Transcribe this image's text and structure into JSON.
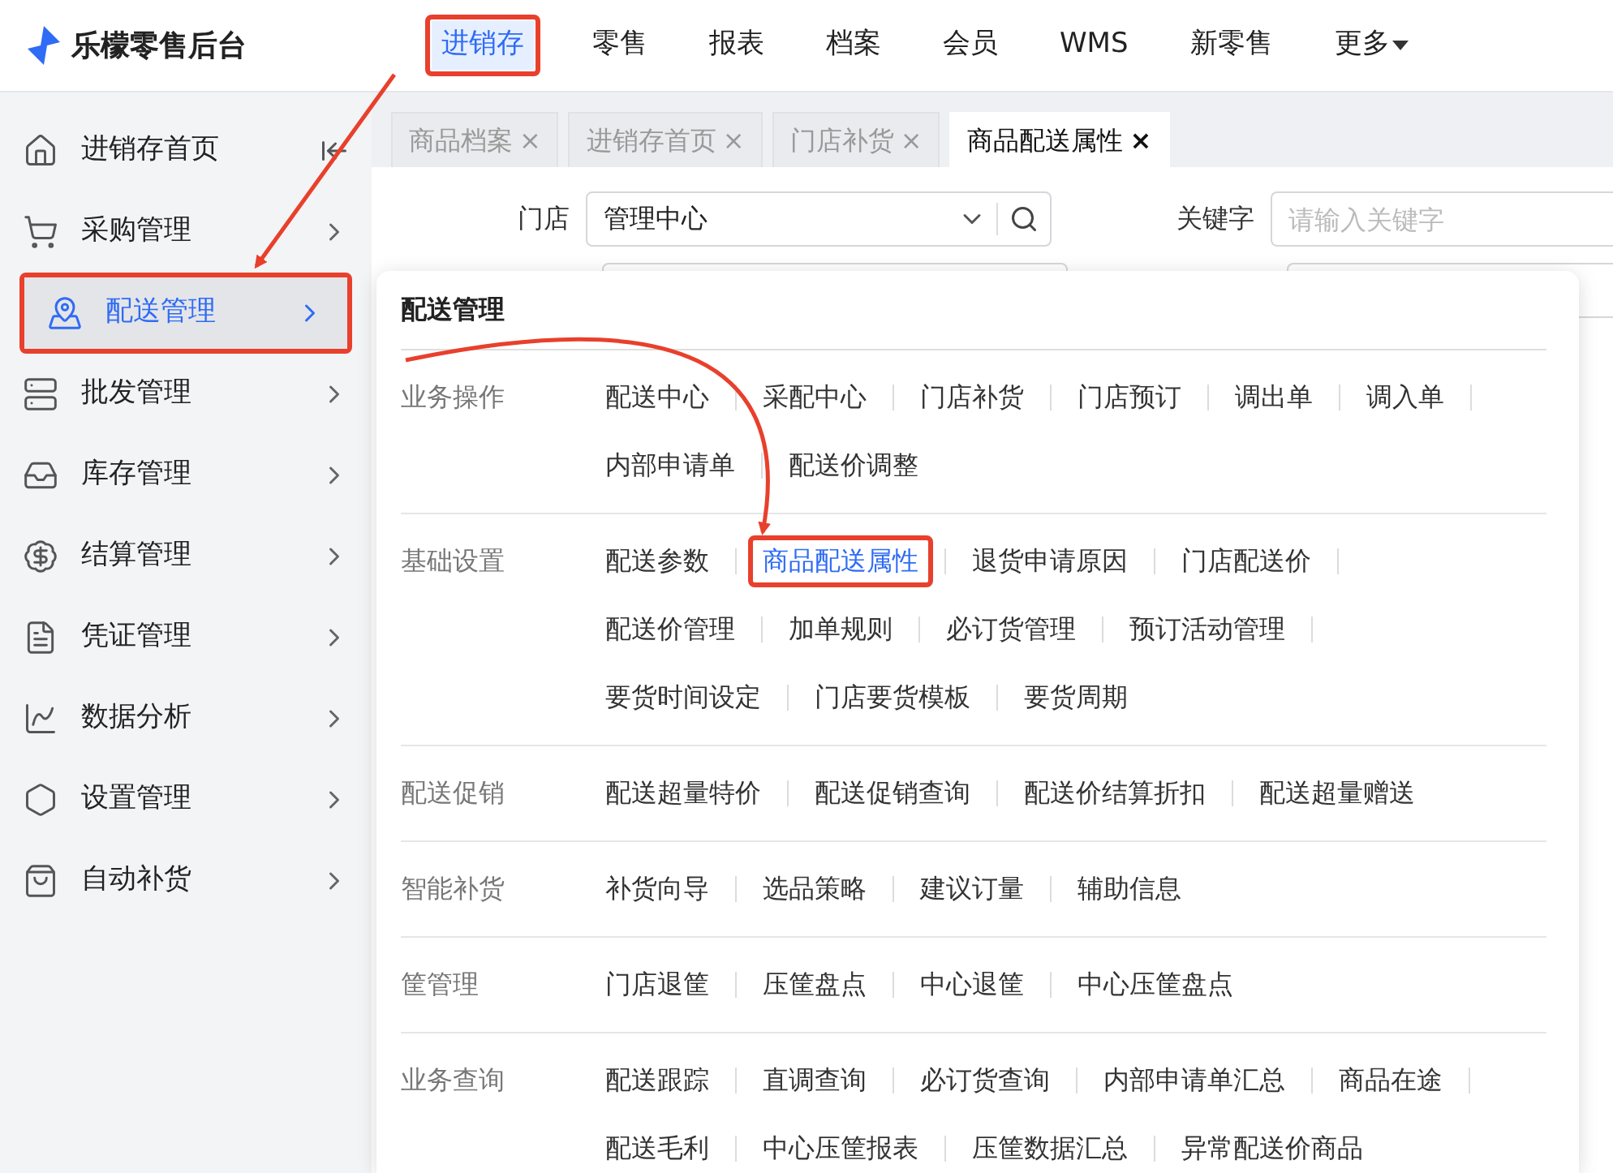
{
  "brand": {
    "name": "乐檬零售后台"
  },
  "nav": [
    {
      "label": "进销存",
      "selected": true,
      "annotated": true,
      "kind": "plain"
    },
    {
      "label": "零售",
      "selected": false,
      "annotated": false,
      "kind": "plain"
    },
    {
      "label": "报表",
      "selected": false,
      "annotated": false,
      "kind": "plain"
    },
    {
      "label": "档案",
      "selected": false,
      "annotated": false,
      "kind": "plain"
    },
    {
      "label": "会员",
      "selected": false,
      "annotated": false,
      "kind": "plain"
    },
    {
      "label": "WMS",
      "selected": false,
      "annotated": false,
      "kind": "plain"
    },
    {
      "label": "新零售",
      "selected": false,
      "annotated": false,
      "kind": "plain"
    },
    {
      "label": "更多",
      "selected": false,
      "annotated": false,
      "kind": "dropdown"
    }
  ],
  "sidebar": {
    "items": [
      {
        "label": "进销存首页",
        "kind": "home",
        "selected": false,
        "annotated": false
      },
      {
        "label": "采购管理",
        "kind": "cart",
        "selected": false,
        "annotated": false
      },
      {
        "label": "配送管理",
        "kind": "map",
        "selected": true,
        "annotated": true
      },
      {
        "label": "批发管理",
        "kind": "server",
        "selected": false,
        "annotated": false
      },
      {
        "label": "库存管理",
        "kind": "box",
        "selected": false,
        "annotated": false
      },
      {
        "label": "结算管理",
        "kind": "money",
        "selected": false,
        "annotated": false
      },
      {
        "label": "凭证管理",
        "kind": "doc",
        "selected": false,
        "annotated": false
      },
      {
        "label": "数据分析",
        "kind": "chart",
        "selected": false,
        "annotated": false
      },
      {
        "label": "设置管理",
        "kind": "settings",
        "selected": false,
        "annotated": false
      },
      {
        "label": "自动补货",
        "kind": "bag",
        "selected": false,
        "annotated": false
      }
    ]
  },
  "tabs": [
    {
      "label": "商品档案",
      "close": "×",
      "selected": false
    },
    {
      "label": "进销存首页",
      "close": "×",
      "selected": false
    },
    {
      "label": "门店补货",
      "close": "×",
      "selected": false
    },
    {
      "label": "商品配送属性",
      "close": "×",
      "selected": true
    }
  ],
  "filters": {
    "store_label": "门店",
    "store_value": "管理中心",
    "keyword_label": "关键字",
    "keyword_placeholder": "请输入关键字"
  },
  "menu": {
    "title": "配送管理",
    "sections": [
      {
        "label": "业务操作",
        "rows": [
          [
            {
              "label": "配送中心",
              "selected": false,
              "annotated": false
            },
            {
              "label": "采配中心",
              "selected": false,
              "annotated": false
            },
            {
              "label": "门店补货",
              "selected": false,
              "annotated": false
            },
            {
              "label": "门店预订",
              "selected": false,
              "annotated": false
            },
            {
              "label": "调出单",
              "selected": false,
              "annotated": false
            },
            {
              "label": "调入单",
              "selected": false,
              "annotated": false
            }
          ],
          [
            {
              "label": "内部申请单",
              "selected": false,
              "annotated": false
            },
            {
              "label": "配送价调整",
              "selected": false,
              "annotated": false
            }
          ]
        ]
      },
      {
        "label": "基础设置",
        "rows": [
          [
            {
              "label": "配送参数",
              "selected": false,
              "annotated": false
            },
            {
              "label": "商品配送属性",
              "selected": true,
              "annotated": true
            },
            {
              "label": "退货申请原因",
              "selected": false,
              "annotated": false
            },
            {
              "label": "门店配送价",
              "selected": false,
              "annotated": false
            }
          ],
          [
            {
              "label": "配送价管理",
              "selected": false,
              "annotated": false
            },
            {
              "label": "加单规则",
              "selected": false,
              "annotated": false
            },
            {
              "label": "必订货管理",
              "selected": false,
              "annotated": false
            },
            {
              "label": "预订活动管理",
              "selected": false,
              "annotated": false
            }
          ],
          [
            {
              "label": "要货时间设定",
              "selected": false,
              "annotated": false
            },
            {
              "label": "门店要货模板",
              "selected": false,
              "annotated": false
            },
            {
              "label": "要货周期",
              "selected": false,
              "annotated": false
            }
          ]
        ]
      },
      {
        "label": "配送促销",
        "rows": [
          [
            {
              "label": "配送超量特价",
              "selected": false,
              "annotated": false
            },
            {
              "label": "配送促销查询",
              "selected": false,
              "annotated": false
            },
            {
              "label": "配送价结算折扣",
              "selected": false,
              "annotated": false
            },
            {
              "label": "配送超量赠送",
              "selected": false,
              "annotated": false
            }
          ]
        ]
      },
      {
        "label": "智能补货",
        "rows": [
          [
            {
              "label": "补货向导",
              "selected": false,
              "annotated": false
            },
            {
              "label": "选品策略",
              "selected": false,
              "annotated": false
            },
            {
              "label": "建议订量",
              "selected": false,
              "annotated": false
            },
            {
              "label": "辅助信息",
              "selected": false,
              "annotated": false
            }
          ]
        ]
      },
      {
        "label": "筐管理",
        "rows": [
          [
            {
              "label": "门店退筐",
              "selected": false,
              "annotated": false
            },
            {
              "label": "压筐盘点",
              "selected": false,
              "annotated": false
            },
            {
              "label": "中心退筐",
              "selected": false,
              "annotated": false
            },
            {
              "label": "中心压筐盘点",
              "selected": false,
              "annotated": false
            }
          ]
        ]
      },
      {
        "label": "业务查询",
        "rows": [
          [
            {
              "label": "配送跟踪",
              "selected": false,
              "annotated": false
            },
            {
              "label": "直调查询",
              "selected": false,
              "annotated": false
            },
            {
              "label": "必订货查询",
              "selected": false,
              "annotated": false
            },
            {
              "label": "内部申请单汇总",
              "selected": false,
              "annotated": false
            },
            {
              "label": "商品在途",
              "selected": false,
              "annotated": false
            }
          ],
          [
            {
              "label": "配送毛利",
              "selected": false,
              "annotated": false
            },
            {
              "label": "中心压筐报表",
              "selected": false,
              "annotated": false
            },
            {
              "label": "压筐数据汇总",
              "selected": false,
              "annotated": false
            },
            {
              "label": "异常配送价商品",
              "selected": false,
              "annotated": false
            }
          ]
        ]
      }
    ]
  }
}
